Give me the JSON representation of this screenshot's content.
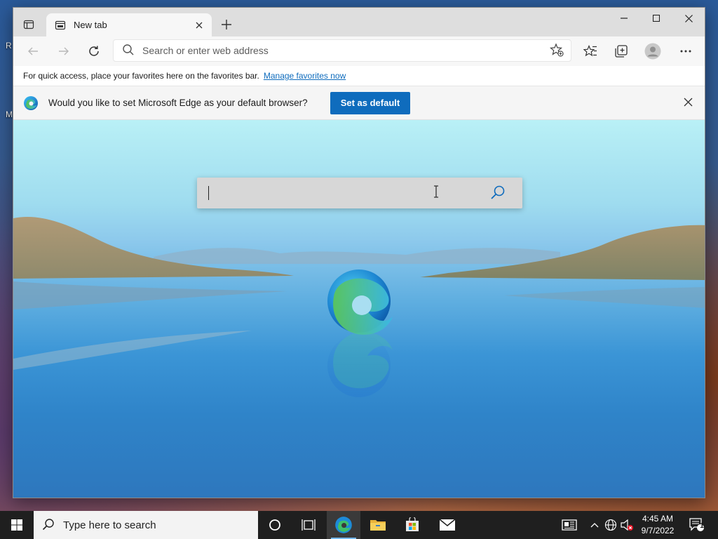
{
  "desktop": {
    "label_1": "R",
    "label_2": "M"
  },
  "browser": {
    "tab_title": "New tab",
    "address_placeholder": "Search or enter web address",
    "favorites_bar": {
      "message": "For quick access, place your favorites here on the favorites bar.",
      "link": "Manage favorites now"
    },
    "infobar": {
      "message": "Would you like to set Microsoft Edge as your default browser?",
      "button": "Set as default"
    },
    "ntp_search_value": ""
  },
  "taskbar": {
    "search_placeholder": "Type here to search",
    "clock_time": "4:45 AM",
    "clock_date": "9/7/2022",
    "notification_count": "1",
    "colors": {
      "background": "#1f1f1f",
      "active_indicator": "#76b9ed"
    }
  },
  "colors": {
    "accent": "#0f6cbd",
    "tabstrip": "#dedede",
    "toolbar": "#f7f7f7"
  }
}
